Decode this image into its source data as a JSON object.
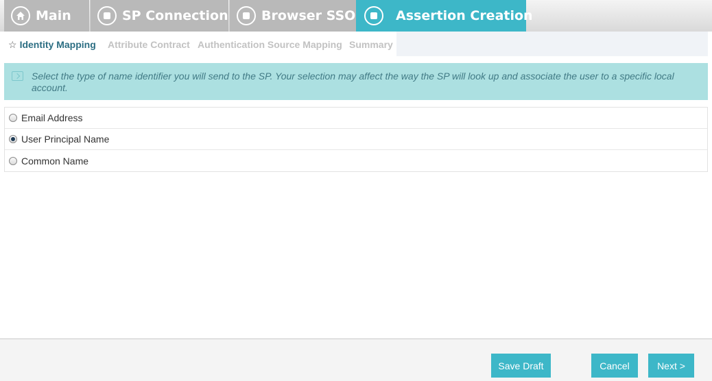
{
  "top_tabs": {
    "main": "Main",
    "sp_connection": "SP Connection",
    "browser_sso": "Browser SSO",
    "assertion_creation": "Assertion Creation"
  },
  "sub_tabs": {
    "identity_mapping": "Identity Mapping",
    "attribute_contract": "Attribute Contract",
    "authentication_source_mapping": "Authentication Source Mapping",
    "summary": "Summary",
    "active_icon": "star-icon"
  },
  "info": {
    "text": "Select the type of name identifier you will send to the SP. Your selection may affect the way the SP will look up and associate the user to a specific local account."
  },
  "options": [
    {
      "label": "Email Address",
      "selected": false
    },
    {
      "label": "User Principal Name",
      "selected": true
    },
    {
      "label": "Common Name",
      "selected": false
    }
  ],
  "footer": {
    "save_draft": "Save Draft",
    "cancel": "Cancel",
    "next": "Next >"
  },
  "colors": {
    "accent": "#3db7c8",
    "inactive_tab": "#b9b9b9",
    "info_bg": "#ace0e1",
    "active_subtab": "#2c6e83"
  }
}
